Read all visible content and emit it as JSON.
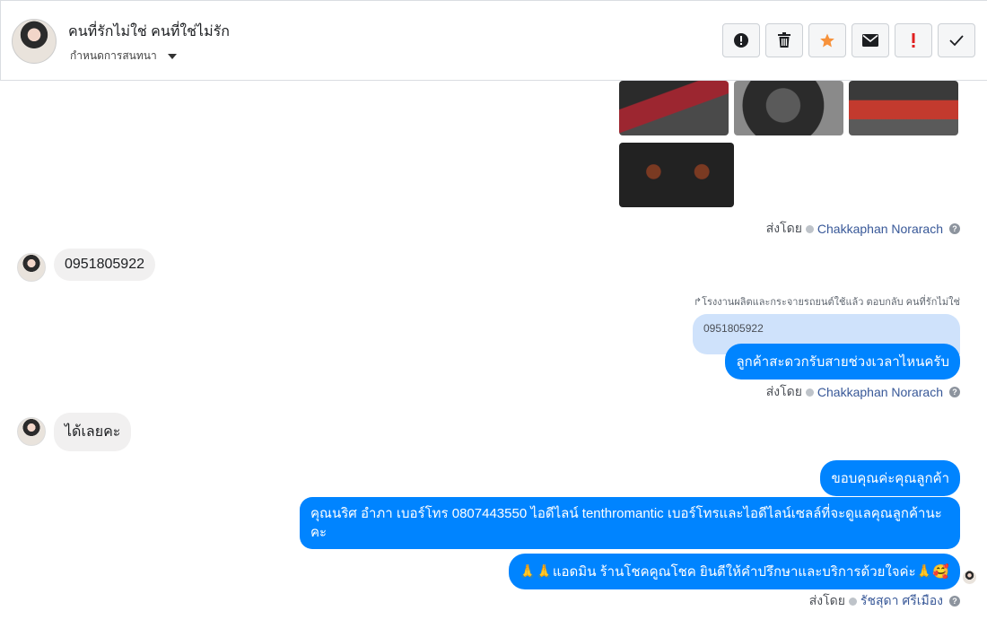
{
  "header": {
    "name": "คนที่รักไม่ใช่ คนที่ใช่ไม่รัก",
    "subtitle": "กำหนดการสนทนา"
  },
  "actions": [
    {
      "icon": "alert-circle-icon",
      "color": "#1c1e21"
    },
    {
      "icon": "trash-icon",
      "color": "#1c1e21"
    },
    {
      "icon": "star-icon",
      "color": "#f7923b"
    },
    {
      "icon": "envelope-icon",
      "color": "#1c1e21"
    },
    {
      "icon": "exclamation-icon",
      "color": "#e02020"
    },
    {
      "icon": "check-icon",
      "color": "#1c1e21"
    }
  ],
  "messages": {
    "sent_by_label": "ส่งโดย",
    "agent_1": "Chakkaphan Norarach",
    "agent_2": "รัชสุดา ศรีเมือง",
    "incoming_1": "0951805922",
    "reply_note": "โรงงานผลิตและกระจายรถยนต์ใช้แล้ว ตอบกลับ คนที่รักไม่ใช่",
    "quoted_text": "0951805922",
    "outgoing_1": "ลูกค้าสะดวกรับสายช่วงเวลาไหนครับ",
    "incoming_2": "ได้เลยคะ",
    "outgoing_2": "ขอบคุณค่ะคุณลูกค้า",
    "outgoing_3": "คุณนริศ อำภา เบอร์โทร 0807443550 ไอดีไลน์ tenthromantic เบอร์โทรและไอดีไลน์เซลล์ที่จะดูแลคุณลูกค้านะคะ",
    "outgoing_4": "🙏🙏แอดมิน ร้านโชคคูณโชค ยินดีให้คำปรึกษาและบริการด้วยใจค่ะ🙏🥰"
  },
  "colors": {
    "outgoing_bubble": "#0084ff",
    "incoming_bubble": "#f1f0f0",
    "quoted_bubble": "#cfe2fb",
    "link": "#385898"
  }
}
